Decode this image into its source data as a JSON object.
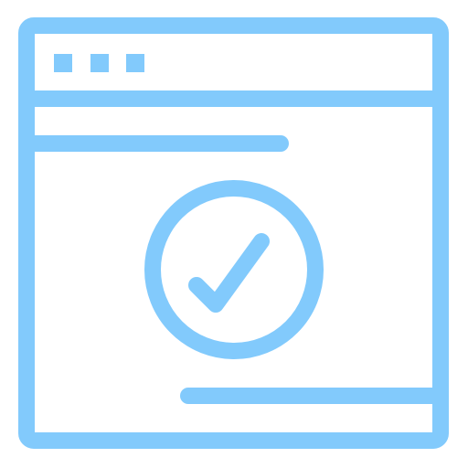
{
  "icon": {
    "name": "browser-window-checkmark-icon",
    "stroke_color": "#82CAFC",
    "parts": [
      "browser-window-icon",
      "window-control-dots-icon",
      "header-line-icon",
      "check-circle-icon",
      "checkmark-icon",
      "footer-line-icon"
    ]
  }
}
